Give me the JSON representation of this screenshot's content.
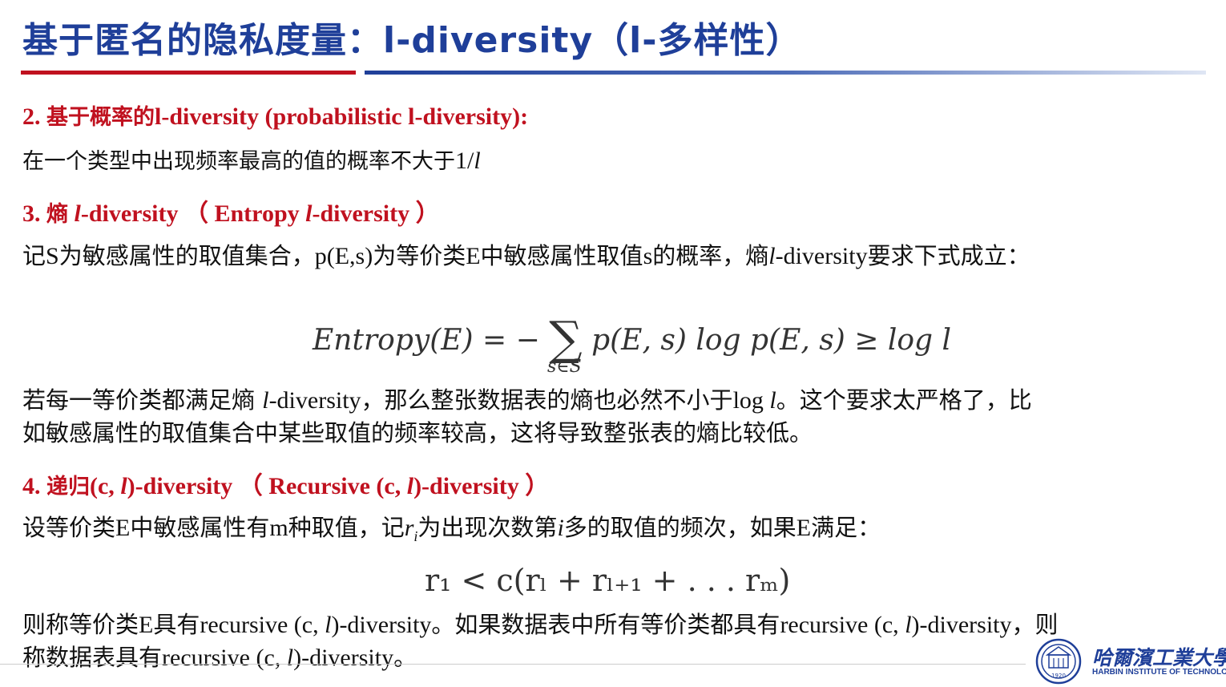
{
  "title": "基于匿名的隐私度量：l-diversity（l-多样性）",
  "section2": {
    "num": "2.",
    "cn": "基于概率的",
    "rest": "l-diversity (probabilistic l-diversity):",
    "body_cn": "在一个类型中出现频率最高的值的概率不大于",
    "body_frac": "1/",
    "body_var": "l"
  },
  "section3": {
    "num": "3.",
    "cn": "熵",
    "var": "l",
    "rest1": "-diversity （ Entropy ",
    "var2": "l",
    "rest2": "-diversity ）",
    "body": {
      "a": "记",
      "b": "S",
      "c": "为敏感属性的取值集合，",
      "d": "p(E,s)",
      "e": "为等价类",
      "f": "E",
      "g": "中敏感属性取值",
      "h": "s",
      "i": "的概率，熵",
      "j": "l",
      "k": "-diversity",
      "l": "要求下式成立："
    },
    "formula": {
      "lhs": "Entropy(E) = −",
      "sum": "∑",
      "sub": "s∈S",
      "rhs": "p(E, s) log p(E, s) ≥ log l"
    },
    "para2_line1": {
      "a": "若每一等价类都满足熵 ",
      "b": "l",
      "c": "-diversity",
      "d": "，那么整张数据表的熵也必然不小于",
      "e": "log ",
      "f": "l",
      "g": "。这个要求太严格了，比"
    },
    "para2_line2": "如敏感属性的取值集合中某些取值的频率较高，这将导致整张表的熵比较低。"
  },
  "section4": {
    "num": "4.",
    "cn": "递归",
    "r1": "(c, ",
    "var": "l",
    "r2": ")-diversity （ Recursive (c, ",
    "var2": "l",
    "r3": ")-diversity ）",
    "body": {
      "a": "设等价类",
      "b": "E",
      "c": "中敏感属性有",
      "d": "m",
      "e": "种取值，记",
      "f": "r",
      "f_sub": "i",
      "g": "为出现次数第",
      "h": "i",
      "i": "多的取值的频次，如果",
      "j": "E",
      "k": "满足："
    },
    "formula": "r₁ < c(rₗ + rₗ₊₁ + . . . rₘ)",
    "para2_line1": {
      "a": "则称等价类",
      "b": "E",
      "c": "具有",
      "d": "recursive (c, ",
      "e": "l",
      "f": ")-diversity",
      "g": "。如果数据表中所有等价类都具有",
      "h": "recursive (c, ",
      "i": "l",
      "j": ")-diversity",
      "k": "，则"
    },
    "para2_line2": {
      "a": "称数据表具有",
      "b": "recursive (c, ",
      "c": "l",
      "d": ")-diversity",
      "e": "。"
    }
  },
  "logo": {
    "cn": "哈爾濱工業大學",
    "en": "HARBIN INSTITUTE OF TECHNOLOGY",
    "year": "1920"
  },
  "colors": {
    "title_blue": "#1f3f99",
    "heading_red": "#c0111f"
  }
}
